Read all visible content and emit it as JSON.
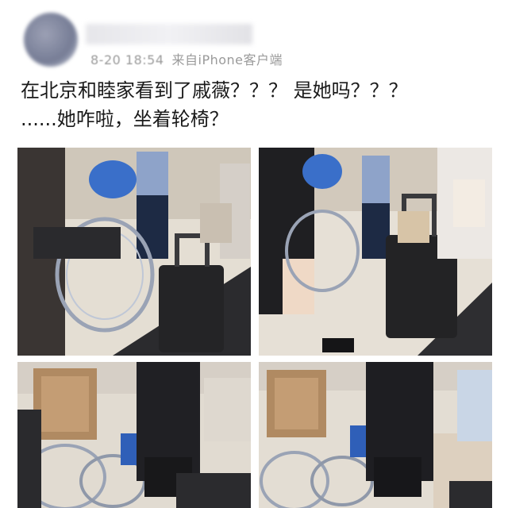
{
  "post": {
    "author": {
      "name": "",
      "avatar": "blurred-avatar"
    },
    "meta": {
      "time": "8-20 18:54",
      "source": "来自iPhone客户端"
    },
    "text": "在北京和睦家看到了戚薇？？？ 是她吗？？？ ......她咋啦，坐着轮椅？",
    "photos": [
      {
        "alt": "wheelchair and black suitcase in lobby"
      },
      {
        "alt": "person pushing wheelchair next to suitcase"
      },
      {
        "alt": "person in black at wheelchair, rear view"
      },
      {
        "alt": "person in black at wheelchair with tote bag"
      }
    ]
  },
  "colors": {
    "background": "#ffffff",
    "meta_text": "#9a9a9a",
    "body_text": "#1a1a1a"
  }
}
